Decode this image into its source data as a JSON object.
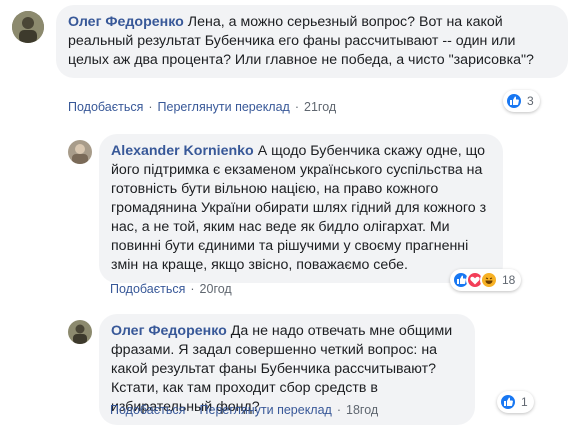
{
  "comments": [
    {
      "author": "Олег Федоренко",
      "text": "Лена, а можно серьезный вопрос? Вот на какой реальный результат Бубенчика его фаны рассчитывают -- один или целых аж два процента? Или главное не победа, а чисто \"зарисовка\"?",
      "like": "Подобається",
      "translate": "Переглянути переклад",
      "time": "21год",
      "reaction_count": "3"
    },
    {
      "author": "Alexander Kornienko",
      "text": "А щодо Бубенчика скажу одне, що його підтримка є екзаменом українського суспільства на готовність бути вільною нацією, на право кожного громадянина України обирати шлях гідний для кожного з нас, а не той, яким нас веде як бидло олігархат. Ми повинні бути єдиними та рішучими у своєму прагненні змін на краще, якщо звісно, поважаємо себе.",
      "like": "Подобається",
      "time": "20год",
      "reaction_count": "18"
    },
    {
      "author": "Олег Федоренко",
      "text": "Да не надо отвечать мне общими фразами. Я задал совершенно четкий вопрос: на какой результат фаны Бубенчика рассчитывают? Кстати, как там проходит сбор средств в избирательный фонд?",
      "like": "Подобається",
      "translate": "Переглянути переклад",
      "time": "18год",
      "reaction_count": "1"
    }
  ],
  "separator": "·"
}
